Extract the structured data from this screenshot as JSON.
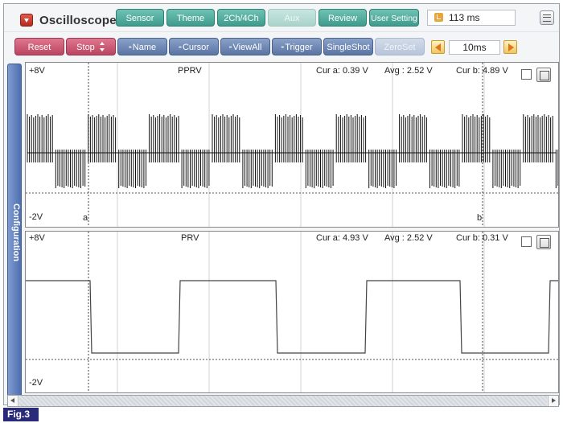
{
  "app": {
    "title": "Oscilloscope"
  },
  "toolbar_top": {
    "sensor": "Sensor",
    "theme": "Theme",
    "channels": "2Ch/4Ch",
    "aux": "Aux",
    "review": "Review",
    "user_setting": "User Setting",
    "elapsed_time": "113 ms"
  },
  "toolbar_bottom": {
    "reset": "Reset",
    "stop": "Stop",
    "name": "Name",
    "cursor": "Cursor",
    "view_all": "ViewAll",
    "trigger": "Trigger",
    "single_shot": "SingleShot",
    "zero_set": "ZeroSet",
    "time_base": "10ms"
  },
  "sidebar": {
    "configuration_label": "Configuration"
  },
  "channels": [
    {
      "name": "PPRV",
      "y_max_label": "+8V",
      "y_min_label": "-2V",
      "cur_a": "Cur a: 0.39 V",
      "avg": "Avg : 2.52 V",
      "cur_b": "Cur b: 4.89 V",
      "cursor_a_label": "a",
      "cursor_b_label": "b",
      "signal_color": "#111111"
    },
    {
      "name": "PRV",
      "y_max_label": "+8V",
      "y_min_label": "-2V",
      "cur_a": "Cur a: 4.93 V",
      "avg": "Avg : 2.52 V",
      "cur_b": "Cur b: 0.31 V",
      "signal_color": "#444444"
    }
  ],
  "figure_label": "Fig.3",
  "colors": {
    "teal_button": "#4fa99b",
    "red_button": "#c9546e",
    "blue_button": "#6a84b3",
    "config_bar": "#5c7cbc",
    "figure_label_bg": "#2a2a7a"
  }
}
